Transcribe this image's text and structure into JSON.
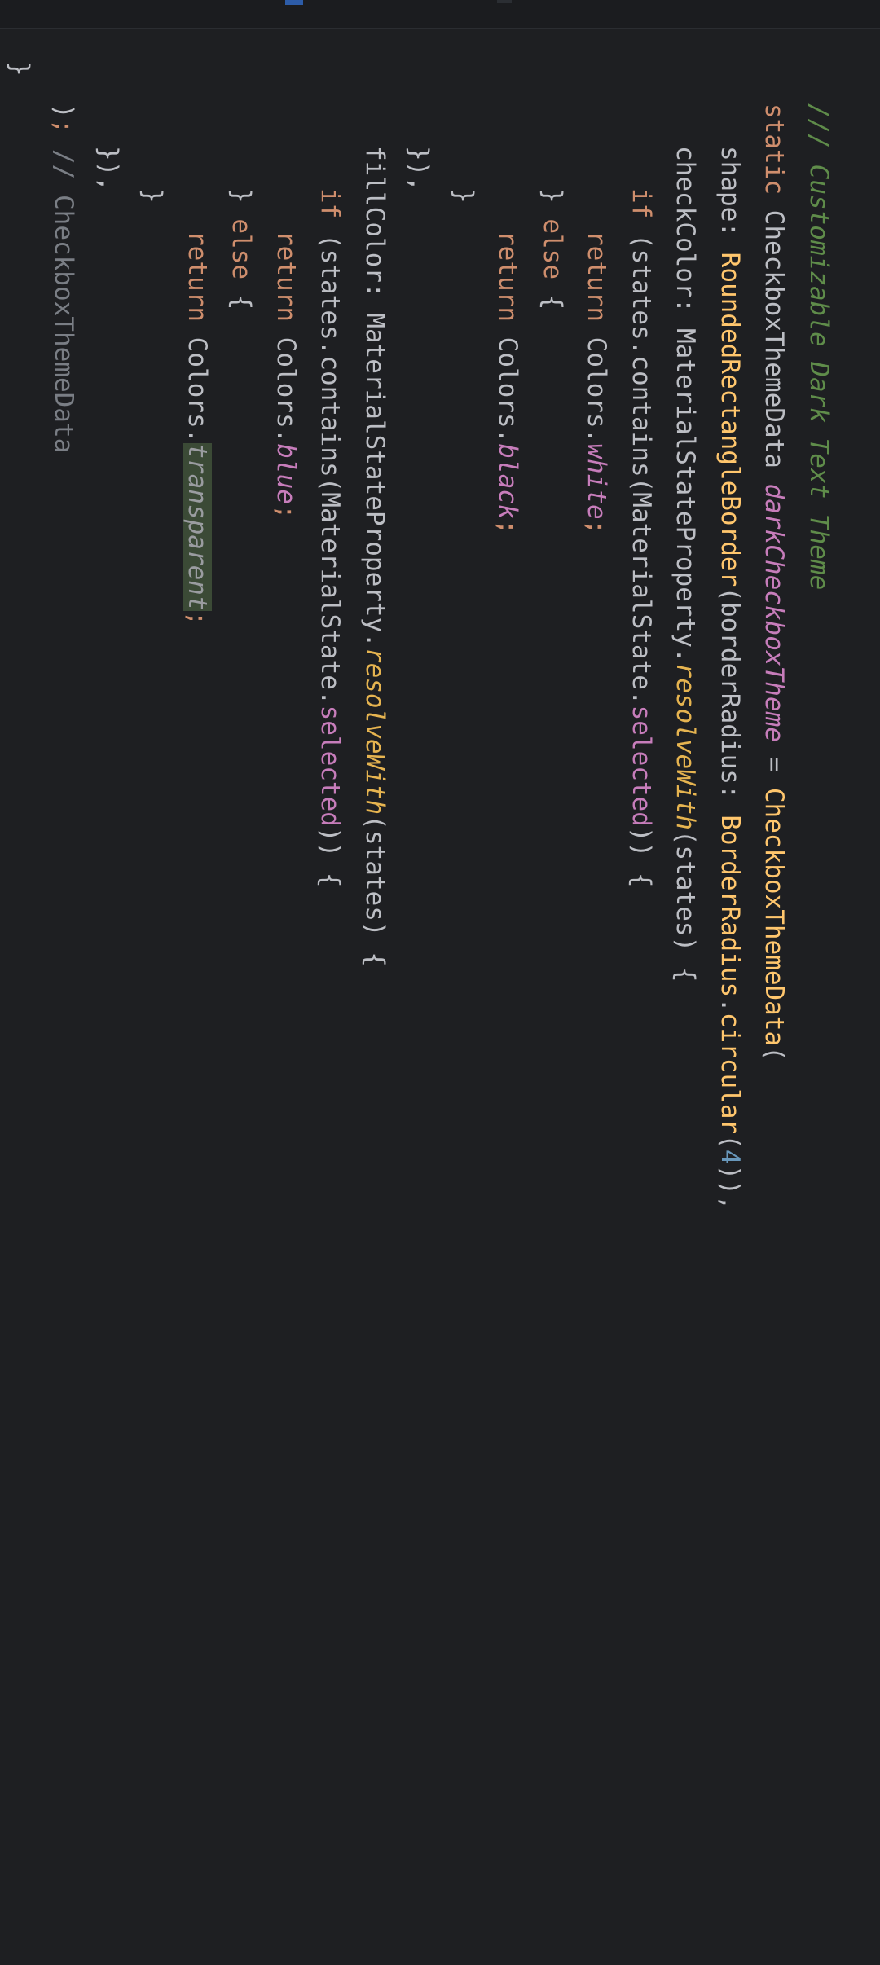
{
  "editor": {
    "lines": [
      {
        "id": "l1",
        "indent": 1,
        "tokens": [
          [
            "comment",
            "/// Customizable Dark Text Theme"
          ]
        ]
      },
      {
        "id": "l2",
        "indent": 1,
        "tokens": [
          [
            "kw",
            "static "
          ],
          [
            "class",
            "CheckboxThemeData "
          ],
          [
            "field",
            "darkCheckboxTheme"
          ],
          [
            "punc",
            " = "
          ],
          [
            "ctor",
            "CheckboxThemeData"
          ],
          [
            "punc",
            "("
          ]
        ]
      },
      {
        "id": "l3",
        "indent": 2,
        "tokens": [
          [
            "punc",
            "shape: "
          ],
          [
            "ctor",
            "RoundedRectangleBorder"
          ],
          [
            "punc",
            "(borderRadius: "
          ],
          [
            "ctor",
            "BorderRadius"
          ],
          [
            "punc",
            "."
          ],
          [
            "ctor",
            "circular"
          ],
          [
            "punc",
            "("
          ],
          [
            "num",
            "4"
          ],
          [
            "punc",
            ")),"
          ]
        ]
      },
      {
        "id": "l4",
        "indent": 2,
        "tokens": [
          [
            "punc",
            "checkColor: MaterialStateProperty."
          ],
          [
            "func",
            "resolveWith"
          ],
          [
            "punc",
            "(states) {"
          ]
        ]
      },
      {
        "id": "l5",
        "indent": 3,
        "tokens": [
          [
            "kw",
            "if "
          ],
          [
            "punc",
            "(states.contains(MaterialState."
          ],
          [
            "prop",
            "selected"
          ],
          [
            "punc",
            ")) {"
          ]
        ]
      },
      {
        "id": "l6",
        "indent": 4,
        "tokens": [
          [
            "kw",
            "return "
          ],
          [
            "punc",
            "Colors."
          ],
          [
            "field",
            "white"
          ],
          [
            "kw",
            ";"
          ]
        ]
      },
      {
        "id": "l7",
        "indent": 3,
        "tokens": [
          [
            "punc",
            "} "
          ],
          [
            "kw",
            "else "
          ],
          [
            "punc",
            "{"
          ]
        ]
      },
      {
        "id": "l8",
        "indent": 4,
        "tokens": [
          [
            "kw",
            "return "
          ],
          [
            "punc",
            "Colors."
          ],
          [
            "field",
            "black"
          ],
          [
            "kw",
            ";"
          ]
        ]
      },
      {
        "id": "l9",
        "indent": 3,
        "tokens": [
          [
            "punc",
            "}"
          ]
        ]
      },
      {
        "id": "l10",
        "indent": 2,
        "tokens": [
          [
            "punc",
            "}),"
          ]
        ]
      },
      {
        "id": "l11",
        "indent": 2,
        "tokens": [
          [
            "punc",
            "fillColor: MaterialStateProperty."
          ],
          [
            "func",
            "resolveWith"
          ],
          [
            "punc",
            "(states) {"
          ]
        ]
      },
      {
        "id": "l12",
        "indent": 3,
        "tokens": [
          [
            "kw",
            "if "
          ],
          [
            "punc",
            "(states.contains(MaterialState."
          ],
          [
            "prop",
            "selected"
          ],
          [
            "punc",
            ")) {"
          ]
        ]
      },
      {
        "id": "l13",
        "indent": 4,
        "tokens": [
          [
            "kw",
            "return "
          ],
          [
            "punc",
            "Colors."
          ],
          [
            "field",
            "blue"
          ],
          [
            "kw",
            ";"
          ]
        ]
      },
      {
        "id": "l14",
        "indent": 3,
        "tokens": [
          [
            "punc",
            "} "
          ],
          [
            "kw",
            "else "
          ],
          [
            "punc",
            "{"
          ]
        ]
      },
      {
        "id": "l15",
        "indent": 4,
        "tokens": [
          [
            "kw",
            "return "
          ],
          [
            "punc",
            "Colors."
          ],
          [
            "hl",
            "transparent"
          ],
          [
            "kw",
            ";"
          ]
        ]
      },
      {
        "id": "l16",
        "indent": 3,
        "tokens": [
          [
            "punc",
            "}"
          ]
        ]
      },
      {
        "id": "l17",
        "indent": 2,
        "tokens": [
          [
            "punc",
            "}), "
          ]
        ]
      },
      {
        "id": "l18",
        "indent": 1,
        "tokens": [
          [
            "punc",
            ")"
          ],
          [
            "kw",
            "; "
          ],
          [
            "trail",
            "// CheckboxThemeData"
          ]
        ]
      },
      {
        "id": "l19",
        "indent": 0,
        "tokens": [
          [
            "punc",
            "}"
          ]
        ]
      }
    ]
  },
  "colors": {
    "background": "#1e1f22",
    "keyword": "#cf8e6d",
    "comment": "#5f8c4a",
    "field": "#c77dbb",
    "function": "#e6b450",
    "number": "#6897bb",
    "text": "#bcbec4",
    "highlight": "#3b4a36"
  }
}
